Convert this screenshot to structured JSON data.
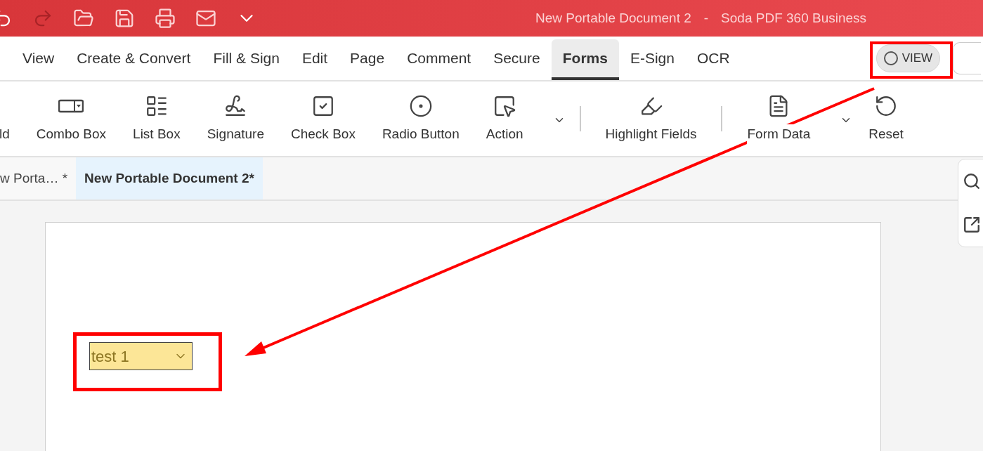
{
  "title_bar": {
    "document": "New Portable Document 2",
    "separator": "-",
    "app": "Soda PDF 360 Business"
  },
  "menu": [
    {
      "label": "View",
      "selected": false
    },
    {
      "label": "Create & Convert",
      "selected": false
    },
    {
      "label": "Fill & Sign",
      "selected": false
    },
    {
      "label": "Edit",
      "selected": false
    },
    {
      "label": "Page",
      "selected": false
    },
    {
      "label": "Comment",
      "selected": false
    },
    {
      "label": "Secure",
      "selected": false
    },
    {
      "label": "Forms",
      "selected": true
    },
    {
      "label": "E-Sign",
      "selected": false
    },
    {
      "label": "OCR",
      "selected": false
    }
  ],
  "view_toggle": {
    "label": "VIEW",
    "on": false
  },
  "ribbon": [
    {
      "label": "ld",
      "kind": "field",
      "has_menu": false
    },
    {
      "label": "Combo Box",
      "kind": "combo",
      "has_menu": false
    },
    {
      "label": "List Box",
      "kind": "list",
      "has_menu": false
    },
    {
      "label": "Signature",
      "kind": "signature",
      "has_menu": false
    },
    {
      "label": "Check Box",
      "kind": "checkbox",
      "has_menu": false
    },
    {
      "label": "Radio Button",
      "kind": "radio",
      "has_menu": false
    },
    {
      "label": "Action",
      "kind": "action",
      "has_menu": true
    },
    {
      "label": "Highlight Fields",
      "kind": "highlight",
      "has_menu": false
    },
    {
      "label": "Form Data",
      "kind": "formdata",
      "has_menu": true
    },
    {
      "label": "Reset",
      "kind": "reset",
      "has_menu": false
    }
  ],
  "document_tabs": [
    {
      "label": "w Porta… *",
      "selected": false
    },
    {
      "label": "New Portable Document 2*",
      "selected": true
    }
  ],
  "form_field": {
    "value": "test 1"
  }
}
